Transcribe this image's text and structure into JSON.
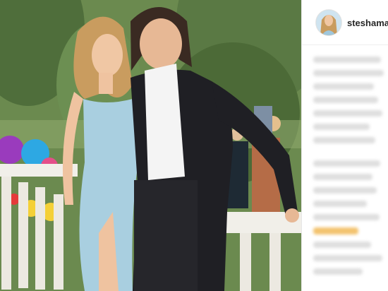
{
  "post": {
    "username": "steshamali",
    "avatar_icon": "profile-avatar",
    "photo": {
      "description_icon": "post-photo",
      "palette": {
        "trees": "#4f6f3a",
        "dress": "#a9cfe0",
        "suit": "#1f1f24",
        "shirt": "#f4f4f4",
        "balustrade": "#f1efe9"
      }
    }
  }
}
